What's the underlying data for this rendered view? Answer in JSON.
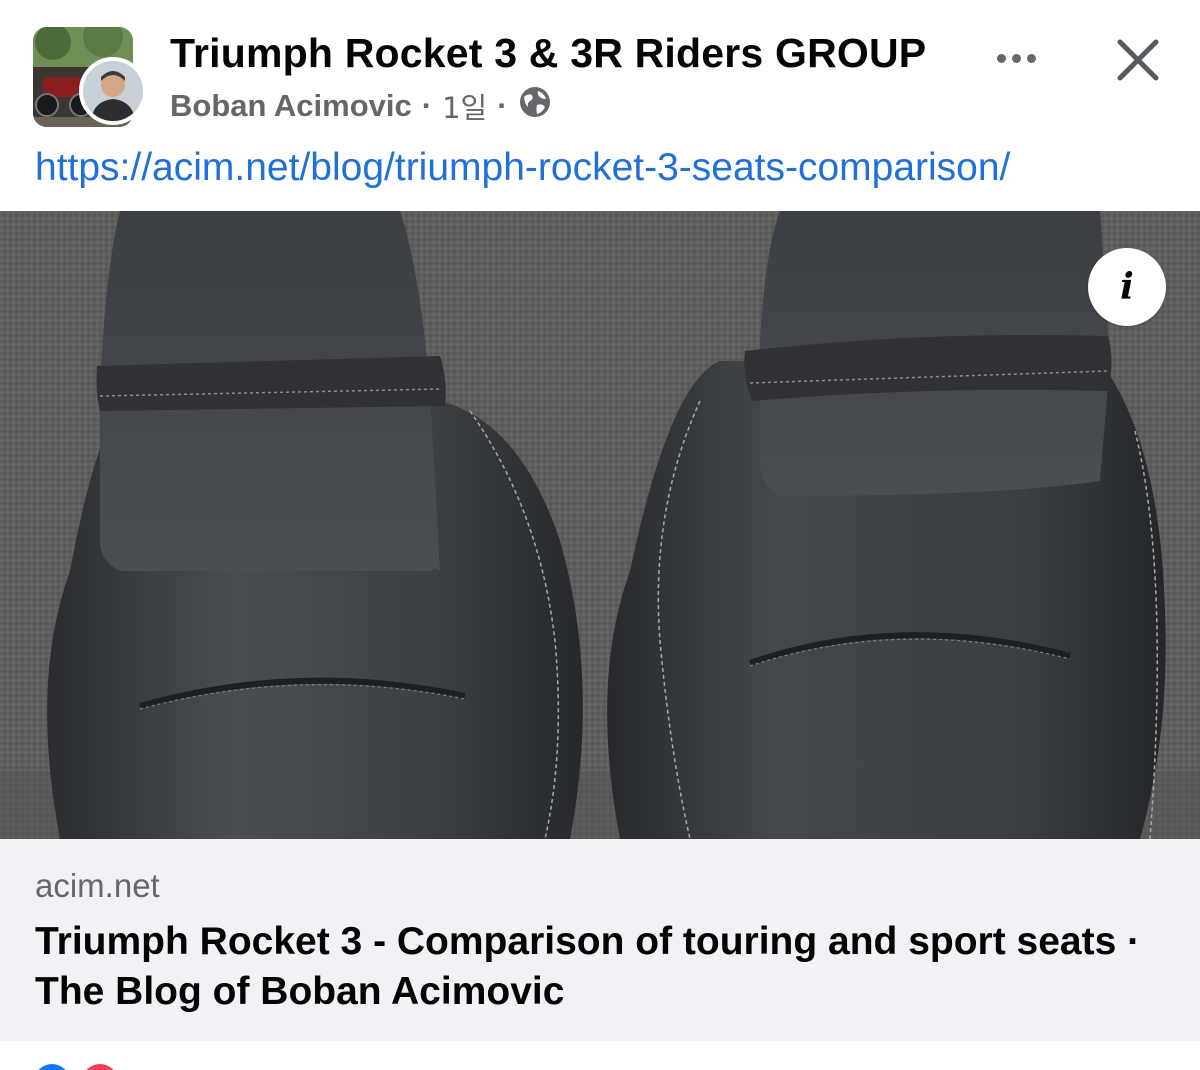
{
  "header": {
    "group_name": "Triumph Rocket 3 & 3R Riders GROUP",
    "author": "Boban Acimovic",
    "separator": "·",
    "time": "1일",
    "audience_icon": "globe-icon",
    "more_icon": "more-icon",
    "close_icon": "close-icon"
  },
  "post": {
    "link_text": "https://acim.net/blog/triumph-rocket-3-seats-comparison/"
  },
  "preview": {
    "info_icon": "info-icon",
    "info_glyph": "i",
    "domain": "acim.net",
    "title": "Triumph Rocket 3 - Comparison of touring and sport seats · The Blog of Boban Acimovic"
  },
  "colors": {
    "link": "#216fdb",
    "secondary_text": "#65676b",
    "card_background": "#f0f2f5"
  }
}
